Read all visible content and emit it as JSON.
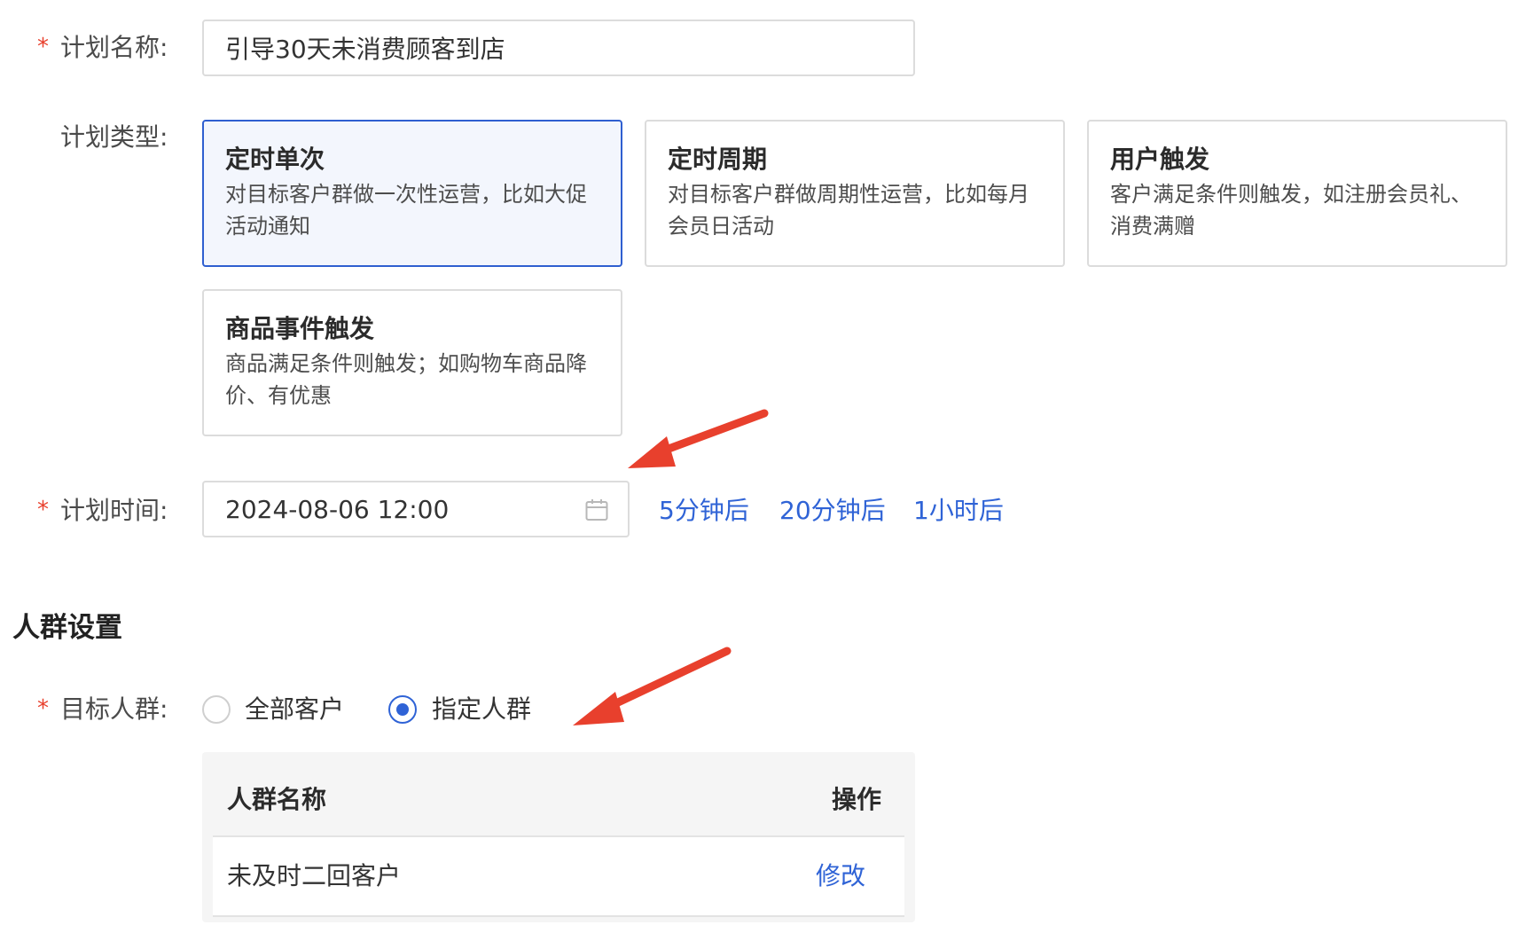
{
  "form": {
    "plan_name": {
      "label": "计划名称:",
      "value": "引导30天未消费顾客到店",
      "required": true
    },
    "plan_type": {
      "label": "计划类型:",
      "options": [
        {
          "title": "定时单次",
          "desc": "对目标客户群做一次性运营，比如大促活动通知",
          "selected": true
        },
        {
          "title": "定时周期",
          "desc": "对目标客户群做周期性运营，比如每月会员日活动",
          "selected": false
        },
        {
          "title": "用户触发",
          "desc": "客户满足条件则触发，如注册会员礼、消费满赠",
          "selected": false
        },
        {
          "title": "商品事件触发",
          "desc": "商品满足条件则触发；如购物车商品降价、有优惠",
          "selected": false
        }
      ]
    },
    "plan_time": {
      "label": "计划时间:",
      "value": "2024-08-06 12:00",
      "required": true,
      "quick_links": [
        "5分钟后",
        "20分钟后",
        "1小时后"
      ]
    }
  },
  "audience": {
    "section_title": "人群设置",
    "target": {
      "label": "目标人群:",
      "required": true,
      "options": [
        {
          "label": "全部客户",
          "checked": false
        },
        {
          "label": "指定人群",
          "checked": true
        }
      ]
    },
    "table": {
      "columns": [
        "人群名称",
        "操作"
      ],
      "rows": [
        {
          "name": "未及时二回客户",
          "action": "修改"
        }
      ]
    }
  },
  "colors": {
    "accent": "#2f63d6",
    "required_star": "#e8402d",
    "annotation_arrow": "#e8402d"
  },
  "icons": {
    "date_picker": "calendar-icon"
  }
}
